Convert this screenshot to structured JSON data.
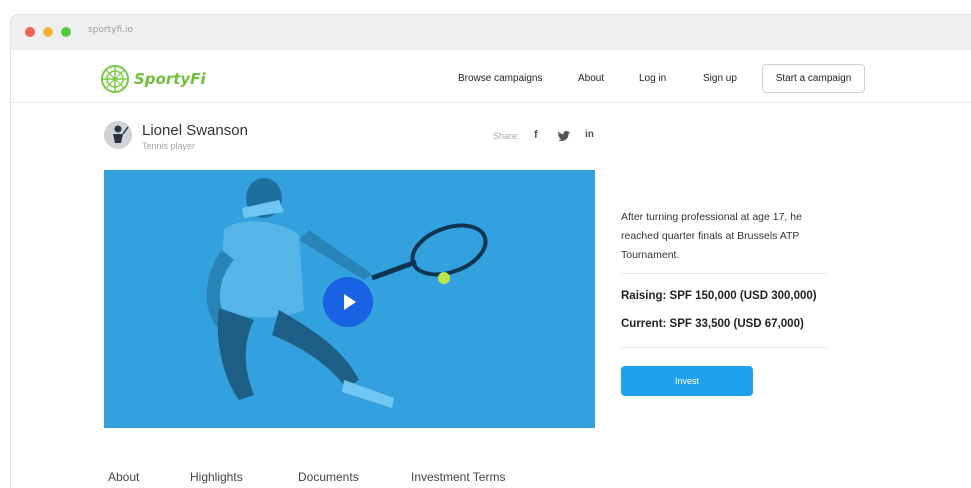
{
  "browser": {
    "url": "sportyfi.io",
    "dots": [
      "#f26158",
      "#f5b23a",
      "#5dc73f"
    ]
  },
  "brand": {
    "name": "SportyFi",
    "color": "#6fbf3b"
  },
  "nav": {
    "links": [
      "Browse campaigns",
      "About",
      "Log in",
      "Sign up"
    ],
    "cta": "Start a campaign"
  },
  "profile": {
    "name": "Lionel Swanson",
    "role": "Tennis player",
    "share_label": "Share:",
    "social_icons": [
      "facebook-icon",
      "twitter-icon",
      "linkedin-icon"
    ]
  },
  "video": {
    "background": "#2f9fdc",
    "play_color": "#1a63e4"
  },
  "campaign": {
    "description": "After turning professional at age 17, he reached quarter finals at Brussels ATP Tournament.",
    "raising": "Raising: SPF 150,000 (USD 300,000)",
    "current": "Current: SPF 33,500 (USD 67,000)",
    "invest_label": "Invest",
    "accent": "#1ea1ee"
  },
  "tabs": [
    "About",
    "Highlights",
    "Documents",
    "Investment Terms"
  ]
}
